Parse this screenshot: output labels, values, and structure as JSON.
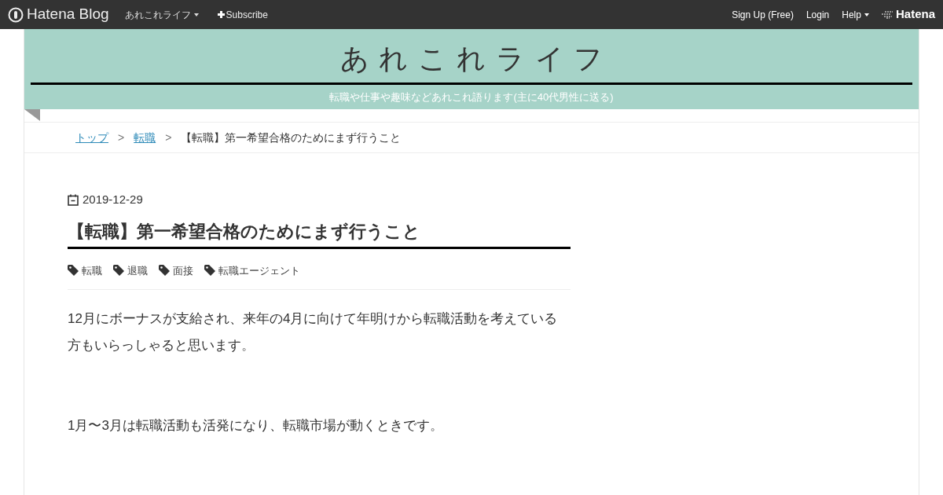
{
  "topbar": {
    "logo": "Hatena Blog",
    "blog_menu": "あれこれライフ",
    "subscribe": "Subscribe",
    "sign_up": "Sign Up (Free)",
    "login": "Login",
    "help": "Help",
    "brand": "Hatena"
  },
  "header": {
    "title": "あれこれライフ",
    "description": "転職や仕事や趣味などあれこれ語ります(主に40代男性に送る)"
  },
  "breadcrumb": [
    {
      "label": "トップ",
      "kind": "link"
    },
    {
      "label": "転職",
      "kind": "link"
    },
    {
      "label": "【転職】第一希望合格のためにまず行うこと",
      "kind": "current"
    }
  ],
  "breadcrumb_separator": ">",
  "article": {
    "date": "2019-12-29",
    "title": "【転職】第一希望合格のためにまず行うこと",
    "tags": [
      "転職",
      "退職",
      "面接",
      "転職エージェント"
    ],
    "paragraphs": [
      "12月にボーナスが支給され、来年の4月に向けて年明けから転職活動を考えている方もいらっしゃると思います。",
      "1月〜3月は転職活動も活発になり、転職市場が動くときです。"
    ]
  }
}
